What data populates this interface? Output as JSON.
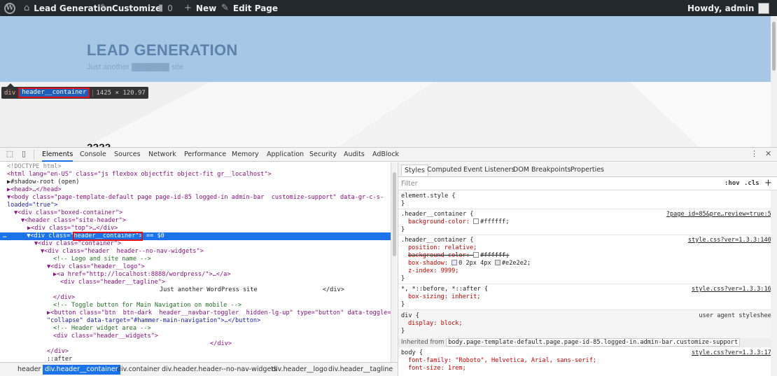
{
  "admin_bar": {
    "site_name": "Lead Generation",
    "customize": "Customize",
    "comments_count": "0",
    "new_label": "New",
    "edit_page": "Edit Page",
    "howdy": "Howdy, admin"
  },
  "site": {
    "title": "LEAD GENERATION",
    "tagline_before": "Just another ",
    "tagline_highlight": "WordPress",
    "tagline_after": " site",
    "section_title": "????"
  },
  "inspect_tooltip": {
    "tag": "div",
    "class_name": "header__container",
    "dimensions": "1425 × 120.97"
  },
  "devtools": {
    "tabs": [
      "Elements",
      "Console",
      "Sources",
      "Network",
      "Performance",
      "Memory",
      "Application",
      "Security",
      "Audits",
      "AdBlock"
    ],
    "active_tab": "Elements",
    "elements": [
      {
        "text": "<!DOCTYPE html>",
        "indent": 1
      },
      {
        "text": "<html lang=\"en-US\" class=\"js flexbox objectfit object-fit gr__localhost\">",
        "indent": 1
      },
      {
        "text": "▶#shadow-root (open)",
        "indent": 1
      },
      {
        "text": "▶<head>…</head>",
        "indent": 1
      },
      {
        "text": "▼<body class=\"page-template-default page page-id-85 logged-in admin-bar  customize-support\" data-gr-c-s-",
        "indent": 1
      },
      {
        "text": "loaded=\"true\">",
        "indent": 1
      },
      {
        "text": "▼<div class=\"boxed-container\">",
        "indent": 2
      },
      {
        "text": "▼<header class=\"site-header\">",
        "indent": 3
      },
      {
        "text": "▶<div class=\"top\">…</div>",
        "indent": 4
      },
      {
        "text": "▼<div class=\"header__container\"> == $0",
        "indent": 4
      },
      {
        "text": "▼<div class=\"container\">",
        "indent": 5
      },
      {
        "text": "▼<div class=\"header  header--no-nav-widgets\">",
        "indent": 6
      },
      {
        "text": "<!-- Logo and site name -->",
        "indent": 7
      },
      {
        "text": "▼<div class=\"header__logo\">",
        "indent": 7
      },
      {
        "text": "▶<a href=\"http://localhost:8888/wordpress/\">…</a>",
        "indent": 8
      },
      {
        "text": "<div class=\"header__tagline\">",
        "indent": 8
      },
      {
        "text": "Just another WordPress site                  </div>",
        "indent": 14
      },
      {
        "text": "</div>",
        "indent": 7
      },
      {
        "text": "<!-- Toggle button for Main Navigation on mobile -->",
        "indent": 7
      },
      {
        "text": "▶<button class=\"btn  btn-dark  header__navbar-toggler  hidden-lg-up\" type=\"button\" data-toggle=",
        "indent": 7
      },
      {
        "text": "\"collapse\" data-target=\"#hammer-main-navigation\">…</button>",
        "indent": 7
      },
      {
        "text": "<!-- Header widget area -->",
        "indent": 7
      },
      {
        "text": "<div class=\"header__widgets\">",
        "indent": 7
      },
      {
        "text": "</div>",
        "indent": 18
      },
      {
        "text": "</div>",
        "indent": 6
      },
      {
        "text": "::after",
        "indent": 6
      }
    ],
    "breadcrumbs": [
      "header",
      "div.header__container",
      "div.container",
      "div.header.header--no-nav-widgets",
      "div.header__logo",
      "div.header__tagline"
    ],
    "active_breadcrumb": "div.header__container",
    "styles_tabs": [
      "Styles",
      "Computed",
      "Event Listeners",
      "DOM Breakpoints",
      "Properties"
    ],
    "filter_placeholder": "Filter",
    "hov": ":hov",
    "cls": ".cls",
    "plus": "+",
    "inherited_from_label": "Inherited from",
    "inherited_from_selector": "body.page-template-default.page.page-id-85.logged-in.admin-bar.customize-support",
    "rules": [
      {
        "selector": "element.style {",
        "source": ""
      },
      {
        "selector": ".header__container {",
        "source": "?page_id=85&pre…review=true:53"
      },
      {
        "selector": ".header__container {",
        "source": "style.css?ver=1.3.3:1406"
      },
      {
        "selector": "*, *::before, *::after {",
        "source": "style.css?ver=1.3.3:164"
      },
      {
        "selector": "div {",
        "source": "user agent stylesheet"
      },
      {
        "selector": "body {",
        "source": "style.css?ver=1.3.3:172"
      }
    ],
    "decls": {
      "r2_bg": "background-color: ",
      "r2_bg_val": "#ffffff;",
      "r3_pos": "position: relative;",
      "r3_bg": "background-color: ",
      "r3_bg_val": "#ffffff;",
      "r3_shadow": "box-shadow: ",
      "r3_shadow_val": "0 2px 4px ",
      "r3_shadow_col": "#e2e2e2;",
      "r3_z": "z-index: 9999;",
      "r4_box": "box-sizing: inherit;",
      "r5_disp": "display: block;",
      "r6_ff": "font-family: \"Roboto\", Helvetica, Arial, sans-serif;",
      "r6_fs": "font-size: 1rem;"
    },
    "colors": {
      "accent": "#1a73e8",
      "admin_bar": "#23282d",
      "header_band": "#a6c8e6",
      "highlight_box": "#e0121b"
    }
  }
}
